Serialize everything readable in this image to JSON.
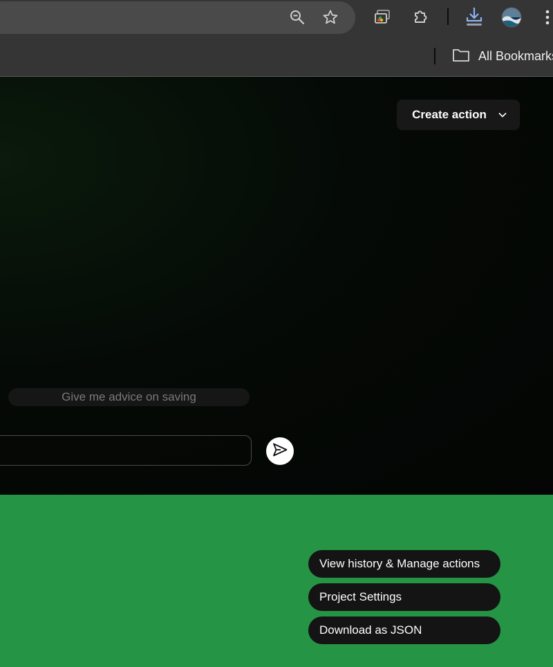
{
  "browser": {
    "toolbar_icons": [
      "zoom-out-icon",
      "star-icon",
      "cast-icon",
      "extensions-icon",
      "download-icon",
      "profile-avatar",
      "more-menu-icon"
    ],
    "bookmarks_folder_label": "All Bookmarks"
  },
  "main": {
    "create_action_label": "Create action",
    "suggestion_label": "Give me advice on saving",
    "chat_input": {
      "value": "",
      "placeholder": ""
    }
  },
  "footer": {
    "view_history_label": "View history & Manage actions",
    "project_settings_label": "Project Settings",
    "download_json_label": "Download as JSON"
  },
  "colors": {
    "footer_bg": "#259445",
    "pill_bg": "#141414",
    "chrome_bg": "#353535",
    "download_accent": "#8ab4f8"
  }
}
